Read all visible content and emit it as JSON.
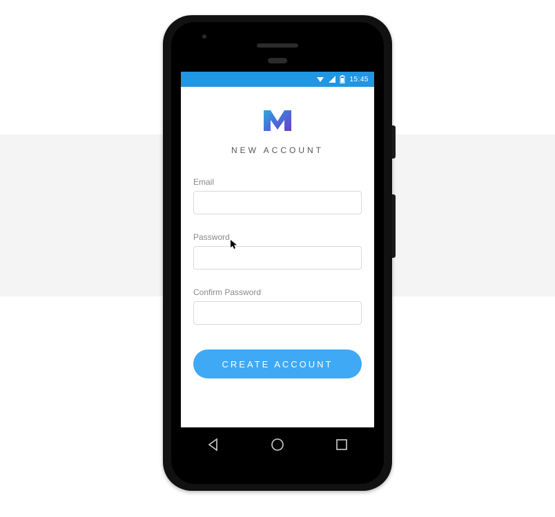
{
  "status": {
    "time": "15:45"
  },
  "app": {
    "subtitle": "NEW ACCOUNT",
    "emailLabel": "Email",
    "passwordLabel": "Password",
    "confirmLabel": "Confirm Password",
    "emailValue": "",
    "passwordValue": "",
    "confirmValue": "",
    "createButton": "CREATE ACCOUNT"
  },
  "colors": {
    "accent": "#3fa9f5",
    "statusbar": "#2196e3"
  }
}
